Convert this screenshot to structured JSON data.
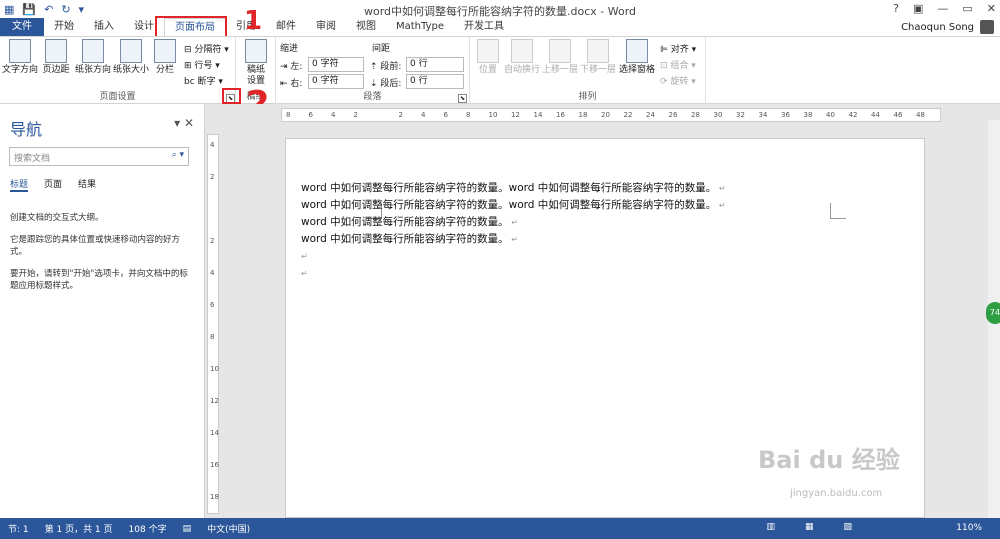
{
  "window": {
    "title": "word中如何调整每行所能容纳字符的数量.docx - Word",
    "controls": [
      "?",
      "▣",
      "—",
      "▭",
      "✕"
    ]
  },
  "qat": {
    "save_icon": "save-icon",
    "undo_icon": "undo-icon",
    "redo_icon": "redo-icon"
  },
  "tabs": [
    "文件",
    "开始",
    "插入",
    "设计",
    "页面布局",
    "引用",
    "邮件",
    "审阅",
    "视图",
    "MathType",
    "开发工具"
  ],
  "user": {
    "name": "Chaoqun Song"
  },
  "ribbon": {
    "page_setup": {
      "label": "页面设置",
      "text_direction": "文字方向",
      "margins": "页边距",
      "orientation": "纸张方向",
      "size": "纸张大小",
      "columns": "分栏",
      "breaks": "分隔符",
      "line_numbers": "行号",
      "hyphenation": "断字"
    },
    "draft": {
      "label": "稿纸",
      "btn": "稿纸\n设置",
      "btn1": "稿纸",
      "btn2": "设置"
    },
    "paragraph": {
      "label": "段落",
      "indent_title": "缩进",
      "spacing_title": "间距",
      "left_label": "左:",
      "left_value": "0 字符",
      "right_label": "右:",
      "right_value": "0 字符",
      "before_label": "段前:",
      "before_value": "0 行",
      "after_label": "段后:",
      "after_value": "0 行"
    },
    "arrange": {
      "label": "排列",
      "position": "位置",
      "wrap": "自动换行",
      "forward": "上移一层",
      "backward": "下移一层",
      "selection_pane": "选择窗格",
      "align": "对齐",
      "group": "组合",
      "rotate": "旋转"
    }
  },
  "annotations": {
    "one": "1",
    "two": "2"
  },
  "nav": {
    "title": "导航",
    "search_placeholder": "搜索文档",
    "tabs": [
      "标题",
      "页面",
      "结果"
    ],
    "text1": "创建文档的交互式大纲。",
    "text2": "它是跟踪您的具体位置或快速移动内容的好方式。",
    "text3": "要开始，请转到\"开始\"选项卡，并向文档中的标题应用标题样式。"
  },
  "ruler": {
    "h_ticks": [
      "8",
      "6",
      "4",
      "2",
      "",
      "2",
      "4",
      "6",
      "8",
      "10",
      "12",
      "14",
      "16",
      "18",
      "20",
      "22",
      "24",
      "26",
      "28",
      "30",
      "32",
      "34",
      "36",
      "38",
      "40",
      "42",
      "44",
      "46",
      "48"
    ],
    "v_ticks": [
      "4",
      "2",
      "",
      "2",
      "4",
      "6",
      "8",
      "10",
      "12",
      "14",
      "16",
      "18"
    ]
  },
  "document": {
    "lines": [
      "word 中如何调整每行所能容纳字符的数量。word 中如何调整每行所能容纳字符的数量。",
      "word 中如何调整每行所能容纳字符的数量。word 中如何调整每行所能容纳字符的数量。",
      "word 中如何调整每行所能容纳字符的数量。",
      "word 中如何调整每行所能容纳字符的数量。",
      "",
      ""
    ],
    "return_mark": "↵"
  },
  "status": {
    "section": "节: 1",
    "page": "第 1 页，共 1 页",
    "words": "108 个字",
    "language": "中文(中国)",
    "zoom": "110%",
    "bubble": "74"
  },
  "watermark": {
    "main": "Bai du 经验",
    "sub": "jingyan.baidu.com"
  }
}
